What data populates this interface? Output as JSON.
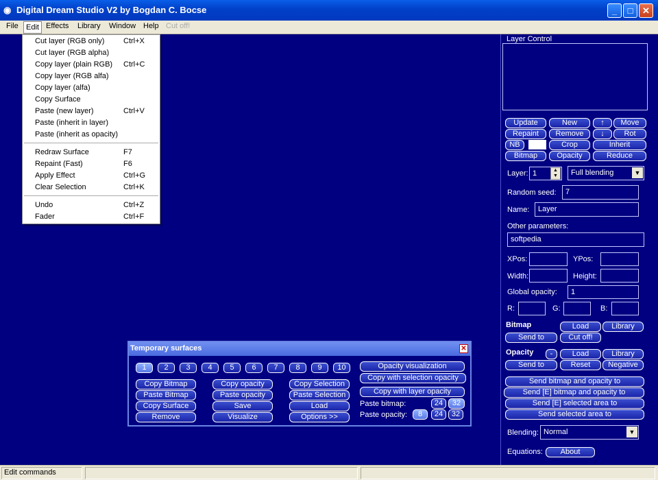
{
  "window": {
    "title": "Digital Dream Studio V2 by Bogdan C. Bocse"
  },
  "menubar": {
    "file": "File",
    "edit": "Edit",
    "effects": "Effects",
    "library": "Library",
    "window": "Window",
    "help": "Help",
    "cutoff": "Cut off!"
  },
  "edit_menu": {
    "items": [
      {
        "label": "Cut layer (RGB only)",
        "key": "Ctrl+X"
      },
      {
        "label": "Cut layer (RGB alpha)",
        "key": ""
      },
      {
        "label": "Copy layer (plain RGB)",
        "key": "Ctrl+C"
      },
      {
        "label": "Copy layer (RGB alfa)",
        "key": ""
      },
      {
        "label": "Copy layer (alfa)",
        "key": ""
      },
      {
        "label": "Copy Surface",
        "key": ""
      },
      {
        "label": "Paste (new layer)",
        "key": "Ctrl+V"
      },
      {
        "label": "Paste (inherit in layer)",
        "key": ""
      },
      {
        "label": "Paste (inherit as opacity)",
        "key": ""
      },
      {
        "label": "Redraw Surface",
        "key": "F7"
      },
      {
        "label": "Repaint (Fast)",
        "key": "F6"
      },
      {
        "label": "Apply Effect",
        "key": "Ctrl+G"
      },
      {
        "label": "Clear Selection",
        "key": "Ctrl+K"
      },
      {
        "label": "Undo",
        "key": "Ctrl+Z"
      },
      {
        "label": "Fader",
        "key": "Ctrl+F"
      }
    ]
  },
  "layer_control": {
    "title": "Layer Control",
    "buttons": {
      "update": "Update",
      "new": "New",
      "up": "↑",
      "move": "Move",
      "repaint": "Repaint",
      "remove": "Remove",
      "down": "↓",
      "rot": "Rot",
      "nb": "NB",
      "crop": "Crop",
      "inherit": "Inherit",
      "bitmap": "Bitmap",
      "opacity": "Opacity",
      "reduce": "Reduce"
    },
    "layer_label": "Layer:",
    "layer_value": "1",
    "blending_mode": "Full blending",
    "random_seed_label": "Random seed:",
    "random_seed_value": "7",
    "name_label": "Name:",
    "name_value": "Layer",
    "other_params_label": "Other parameters:",
    "other_params_value": "softpedia",
    "xpos_label": "XPos:",
    "ypos_label": "YPos:",
    "width_label": "Width:",
    "height_label": "Height:",
    "global_opacity_label": "Global opacity:",
    "global_opacity_value": "1",
    "r_label": "R:",
    "g_label": "G:",
    "b_label": "B:",
    "bitmap_section": "Bitmap",
    "bitmap_load": "Load",
    "bitmap_library": "Library",
    "bitmap_send_to": "Send to",
    "bitmap_cut_off": "Cut off!",
    "opacity_section": "Opacity",
    "opacity_dash": "-",
    "opacity_load": "Load",
    "opacity_library": "Library",
    "opacity_send_to": "Send to",
    "opacity_reset": "Reset",
    "opacity_negative": "Negative",
    "send_bitmap_opacity": "Send bitmap and opacity to",
    "send_e_bitmap_opacity": "Send [E] bitmap and opacity to",
    "send_e_selected": "Send [E] selected area to",
    "send_selected": "Send selected area to",
    "blending_label": "Blending:",
    "blending_value": "Normal",
    "equations_label": "Equations:",
    "about": "About"
  },
  "temp_surfaces": {
    "title": "Temporary surfaces",
    "close": "✕",
    "numbers": [
      "1",
      "2",
      "3",
      "4",
      "5",
      "6",
      "7",
      "8",
      "9",
      "10"
    ],
    "col1": [
      "Copy Bitmap",
      "Paste Bitmap",
      "Copy Surface",
      "Remove"
    ],
    "col2": [
      "Copy opacity",
      "Paste opacity",
      "Save",
      "Visualize"
    ],
    "col3": [
      "Copy Selection",
      "Paste Selection",
      "Load",
      "Options >>"
    ],
    "opacity_visualization": "Opacity visualization",
    "copy_with_selection_opacity": "Copy with selection opacity",
    "copy_with_layer_opacity": "Copy with layer opacity",
    "paste_bitmap_label": "Paste bitmap:",
    "paste_opacity_label": "Paste opacity:",
    "bits": [
      "8",
      "24",
      "32"
    ]
  },
  "statusbar": {
    "text": "Edit commands"
  }
}
